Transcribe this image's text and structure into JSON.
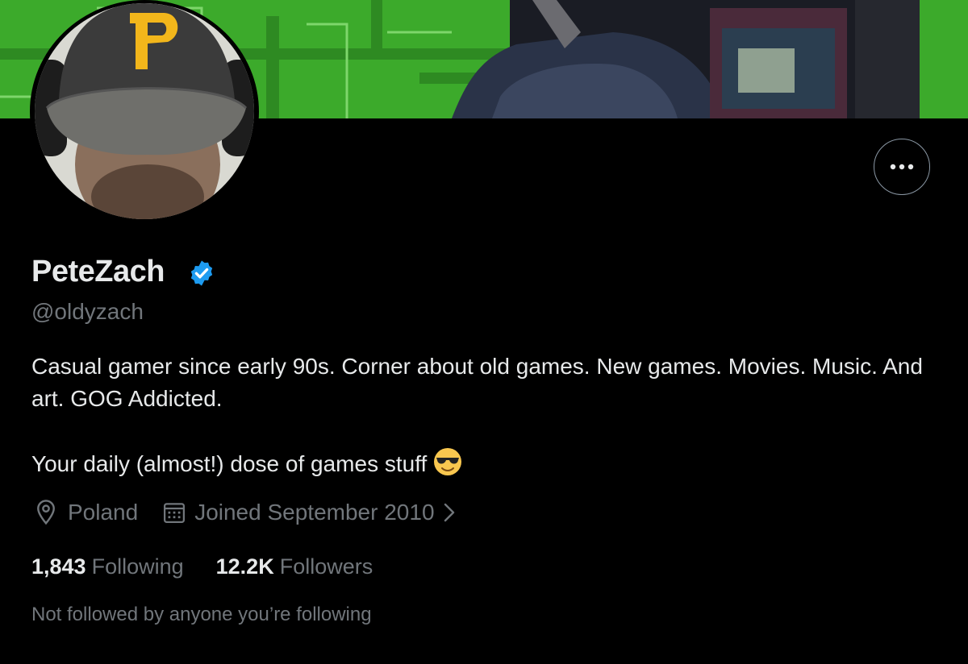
{
  "profile": {
    "display_name": "PeteZach",
    "handle": "@oldyzach",
    "bio_line1": "Casual gamer since early 90s. Corner about old games. New games.  Movies. Music. And art. GOG Addicted.",
    "bio_line2": "Your daily (almost!) dose of games stuff",
    "bio_emoji": "smiling-face-with-sunglasses-icon",
    "location": "Poland",
    "joined": "Joined September 2010",
    "following_count": "1,843",
    "following_label": "Following",
    "followers_count": "12.2K",
    "followers_label": "Followers",
    "mutuals_note": "Not followed by anyone you’re following",
    "verified": true
  },
  "icons": {
    "more": "more-options-icon",
    "verified": "verified-badge-icon",
    "location": "location-pin-icon",
    "calendar": "calendar-icon",
    "chevron": "chevron-right-icon"
  },
  "colors": {
    "background": "#000000",
    "primary_text": "#e7e9ea",
    "secondary_text": "#71767b",
    "verified_blue": "#1d9bf0",
    "banner_green": "#3aa52a",
    "avatar_cap_letter": "#f2b61b"
  }
}
